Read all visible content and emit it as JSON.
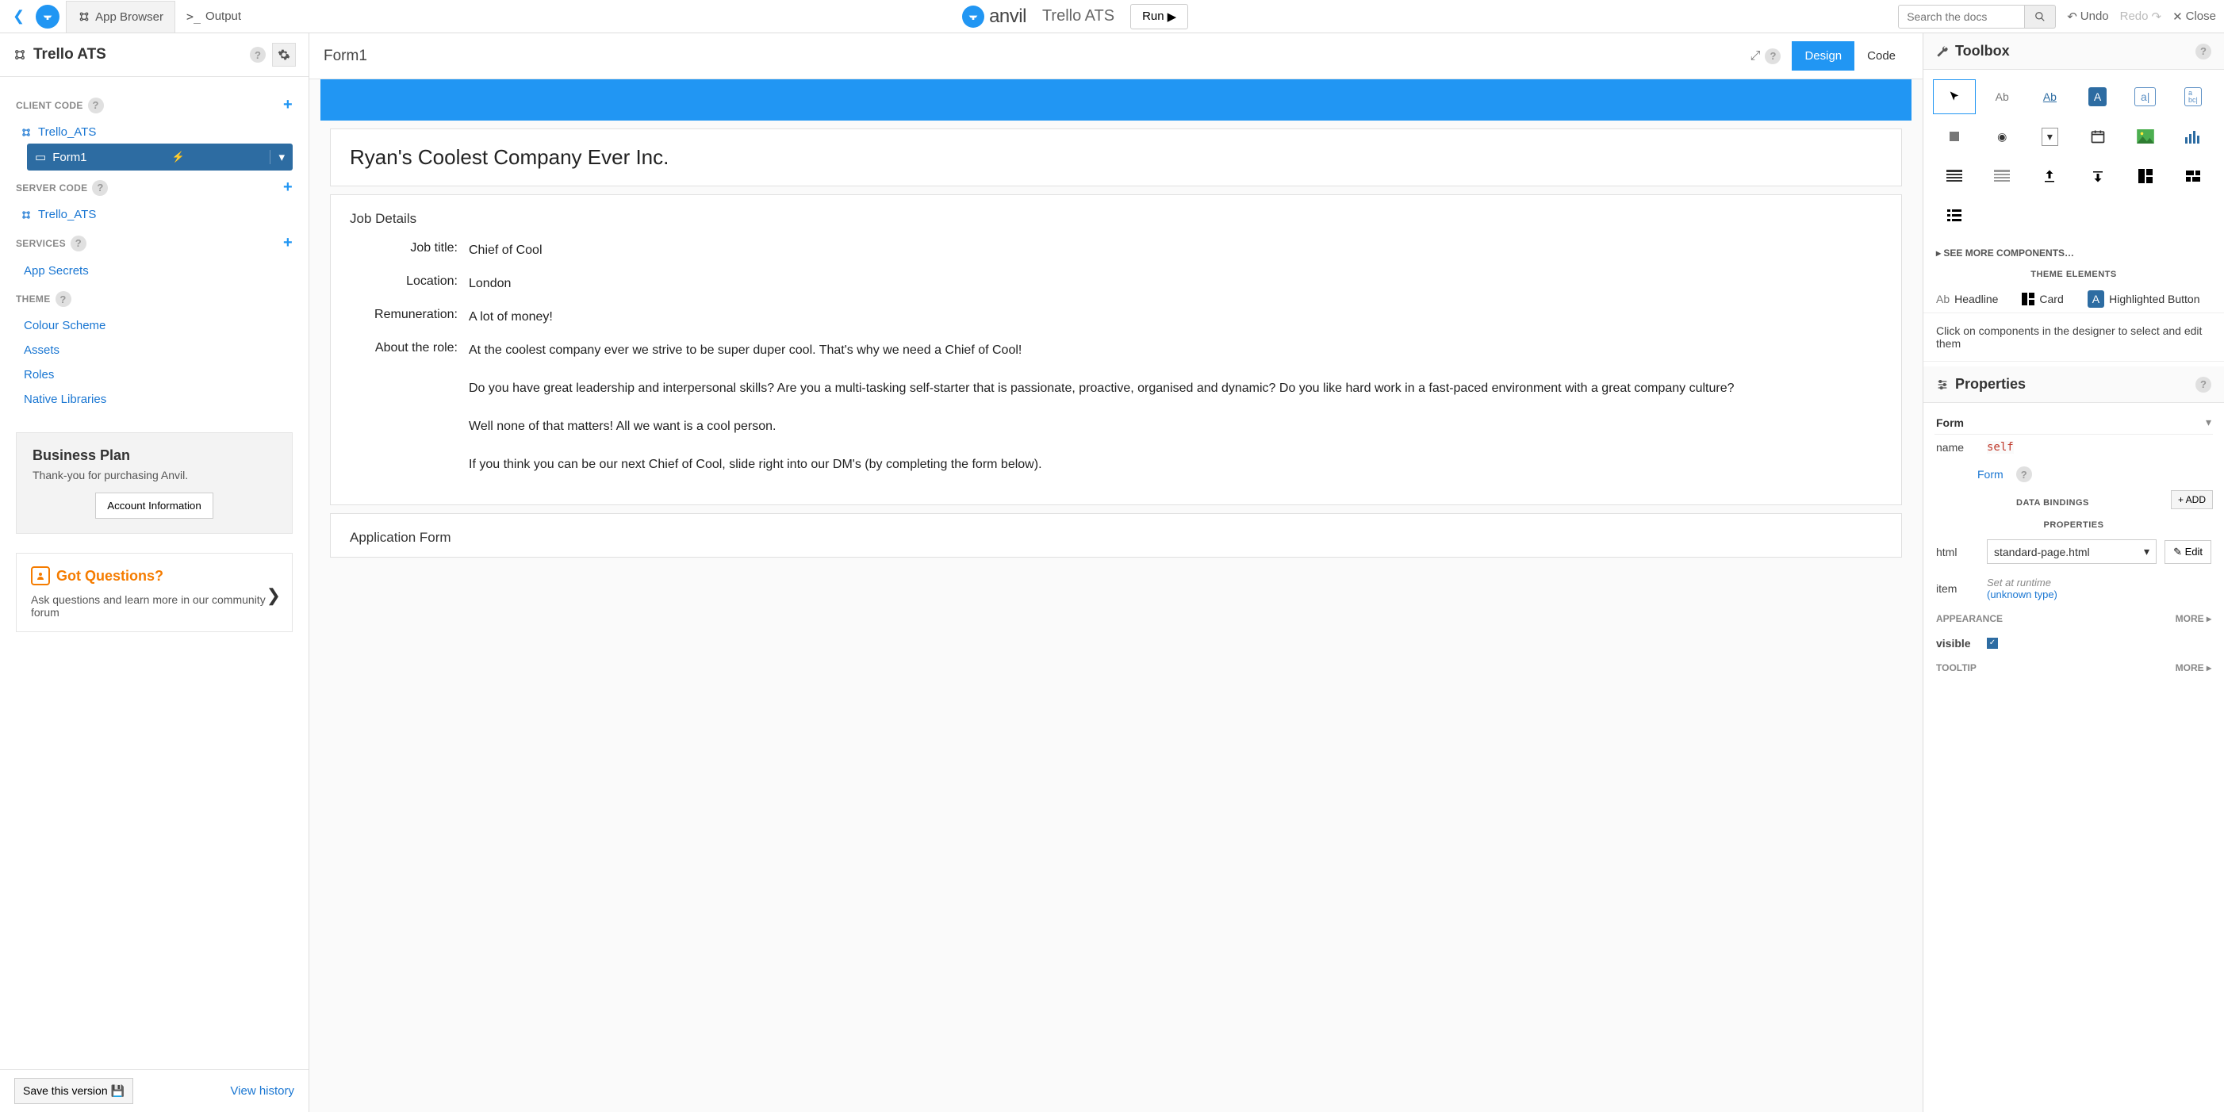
{
  "topbar": {
    "app_browser": "App Browser",
    "output": "Output",
    "brand": "anvil",
    "app_title": "Trello ATS",
    "run": "Run",
    "search_placeholder": "Search the docs",
    "undo": "Undo",
    "redo": "Redo",
    "close": "Close"
  },
  "left": {
    "title": "Trello ATS",
    "client_code": "CLIENT CODE",
    "server_code": "SERVER CODE",
    "services": "SERVICES",
    "theme": "THEME",
    "module_client": "Trello_ATS",
    "form1": "Form1",
    "module_server": "Trello_ATS",
    "app_secrets": "App Secrets",
    "colour_scheme": "Colour Scheme",
    "assets": "Assets",
    "roles": "Roles",
    "native_libraries": "Native Libraries",
    "plan_title": "Business Plan",
    "plan_text": "Thank-you for purchasing Anvil.",
    "account_info": "Account Information",
    "questions_title": "Got Questions?",
    "questions_text": "Ask questions and learn more in our community forum",
    "save_version": "Save this version",
    "view_history": "View history"
  },
  "center": {
    "form_title": "Form1",
    "design": "Design",
    "code": "Code",
    "company": "Ryan's Coolest Company Ever Inc.",
    "job_details": "Job Details",
    "application_form": "Application Form",
    "fields": {
      "job_title_label": "Job title:",
      "job_title_value": "Chief of Cool",
      "location_label": "Location:",
      "location_value": "London",
      "remuneration_label": "Remuneration:",
      "remuneration_value": "A lot of money!",
      "about_label": "About the role:",
      "about_value": "At the coolest company ever we strive to be super duper cool. That's why we need a Chief of Cool!\n\nDo you have great leadership and interpersonal skills? Are you a multi-tasking self-starter that is passionate, proactive, organised and dynamic? Do you like hard work in a fast-paced environment with a great company culture?\n\nWell none of that matters! All we want is a cool person.\n\nIf you think you can be our next Chief of Cool, slide right into our DM's (by completing the form below)."
    }
  },
  "right": {
    "toolbox": "Toolbox",
    "see_more": "SEE MORE COMPONENTS…",
    "theme_elements": "THEME ELEMENTS",
    "headline": "Headline",
    "card": "Card",
    "highlighted_button": "Highlighted Button",
    "hint": "Click on components in the designer to select and edit them",
    "properties": "Properties",
    "form": "Form",
    "name_label": "name",
    "name_value": "self",
    "form_link": "Form",
    "data_bindings": "DATA BINDINGS",
    "add": "ADD",
    "properties_sub": "PROPERTIES",
    "html_label": "html",
    "html_value": "standard-page.html",
    "edit": "Edit",
    "item_label": "item",
    "item_runtime": "Set at runtime",
    "item_type": "(unknown type)",
    "appearance": "APPEARANCE",
    "more": "MORE",
    "visible": "visible",
    "tooltip": "TOOLTIP"
  }
}
